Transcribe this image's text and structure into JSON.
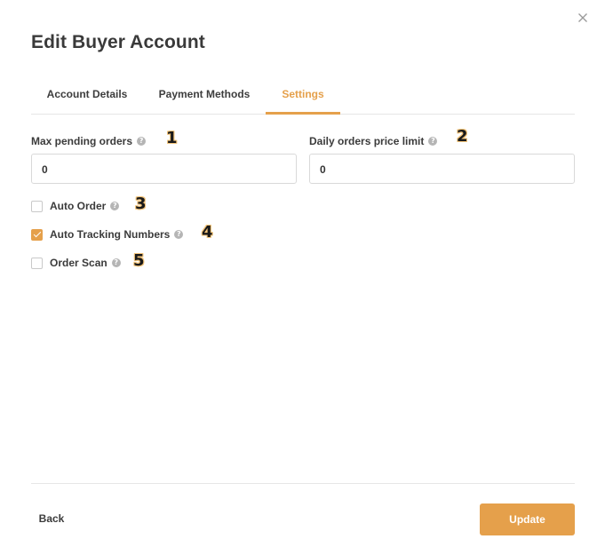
{
  "dialog": {
    "title": "Edit Buyer Account",
    "close_icon": "close-icon"
  },
  "tabs": [
    {
      "label": "Account Details",
      "active": false
    },
    {
      "label": "Payment Methods",
      "active": false
    },
    {
      "label": "Settings",
      "active": true
    }
  ],
  "fields": {
    "max_pending_orders": {
      "label": "Max pending orders",
      "value": "0",
      "help_icon": "help-icon"
    },
    "daily_orders_price_limit": {
      "label": "Daily orders price limit",
      "value": "0",
      "help_icon": "help-icon"
    }
  },
  "options": [
    {
      "label": "Auto Order",
      "checked": false
    },
    {
      "label": "Auto Tracking Numbers",
      "checked": true
    },
    {
      "label": "Order Scan",
      "checked": false
    }
  ],
  "markers": [
    "1",
    "2",
    "3",
    "4",
    "5"
  ],
  "help_glyph": "?",
  "footer": {
    "back_label": "Back",
    "update_label": "Update"
  },
  "colors": {
    "accent": "#e5a04b",
    "text": "#3b3b3b",
    "border": "#d9d9d9"
  }
}
